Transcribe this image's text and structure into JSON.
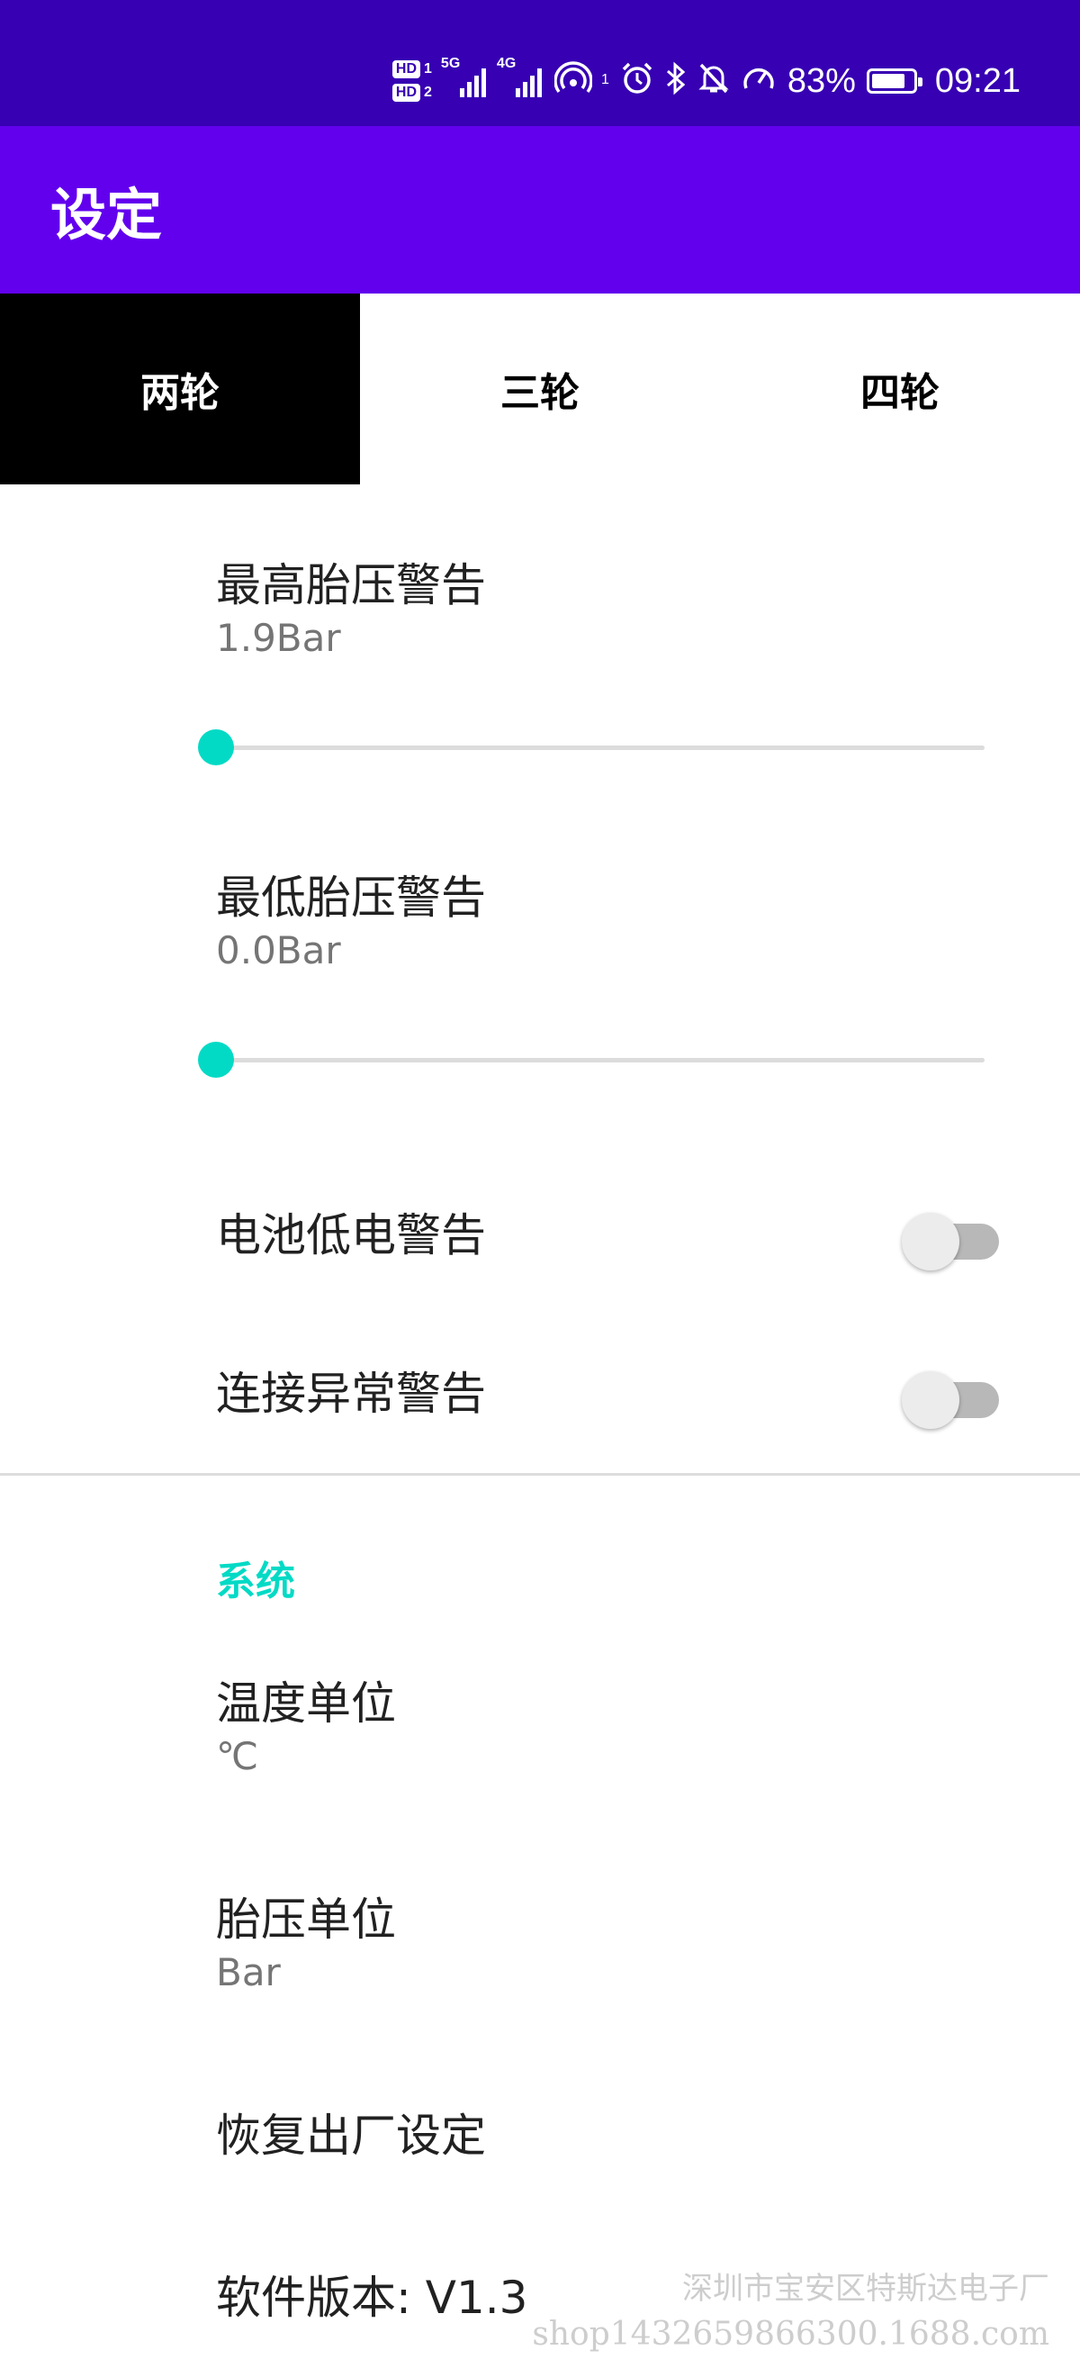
{
  "status_bar": {
    "hd1": "HD",
    "hd1_num": "1",
    "hd2": "HD",
    "hd2_num": "2",
    "net1": "5G",
    "net2": "4G",
    "hotspot_sup": "1",
    "battery_percent": "83%",
    "battery_level": 0.83,
    "time": "09:21",
    "icons": [
      "hd-icon",
      "signal-5g-icon",
      "signal-4g-icon",
      "hotspot-icon",
      "alarm-icon",
      "bluetooth-icon",
      "mute-icon",
      "speed-icon",
      "battery-icon"
    ]
  },
  "app_bar": {
    "title": "设定"
  },
  "tabs": [
    {
      "label": "两轮",
      "active": true
    },
    {
      "label": "三轮",
      "active": false
    },
    {
      "label": "四轮",
      "active": false
    }
  ],
  "preferences": {
    "max_pressure": {
      "title": "最高胎压警告",
      "summary": "1.9Bar",
      "slider_value": 0.0
    },
    "min_pressure": {
      "title": "最低胎压警告",
      "summary": "0.0Bar",
      "slider_value": 0.0
    },
    "battery_low": {
      "title": "电池低电警告",
      "enabled": false
    },
    "connection_error": {
      "title": "连接异常警告",
      "enabled": false
    }
  },
  "system": {
    "category": "系统",
    "temp_unit": {
      "title": "温度单位",
      "summary": "℃"
    },
    "pressure_unit": {
      "title": "胎压单位",
      "summary": "Bar"
    },
    "factory_reset": {
      "title": "恢复出厂设定"
    },
    "version": {
      "title": "软件版本: V1.3"
    }
  },
  "watermark": {
    "line1": "深圳市宝安区特斯达电子厂",
    "line2": "shop1432659866300.1688.com"
  },
  "colors": {
    "status_bar": "#3700b3",
    "app_bar": "#6200ee",
    "accent": "#03dac5",
    "active_tab": "#000000"
  }
}
